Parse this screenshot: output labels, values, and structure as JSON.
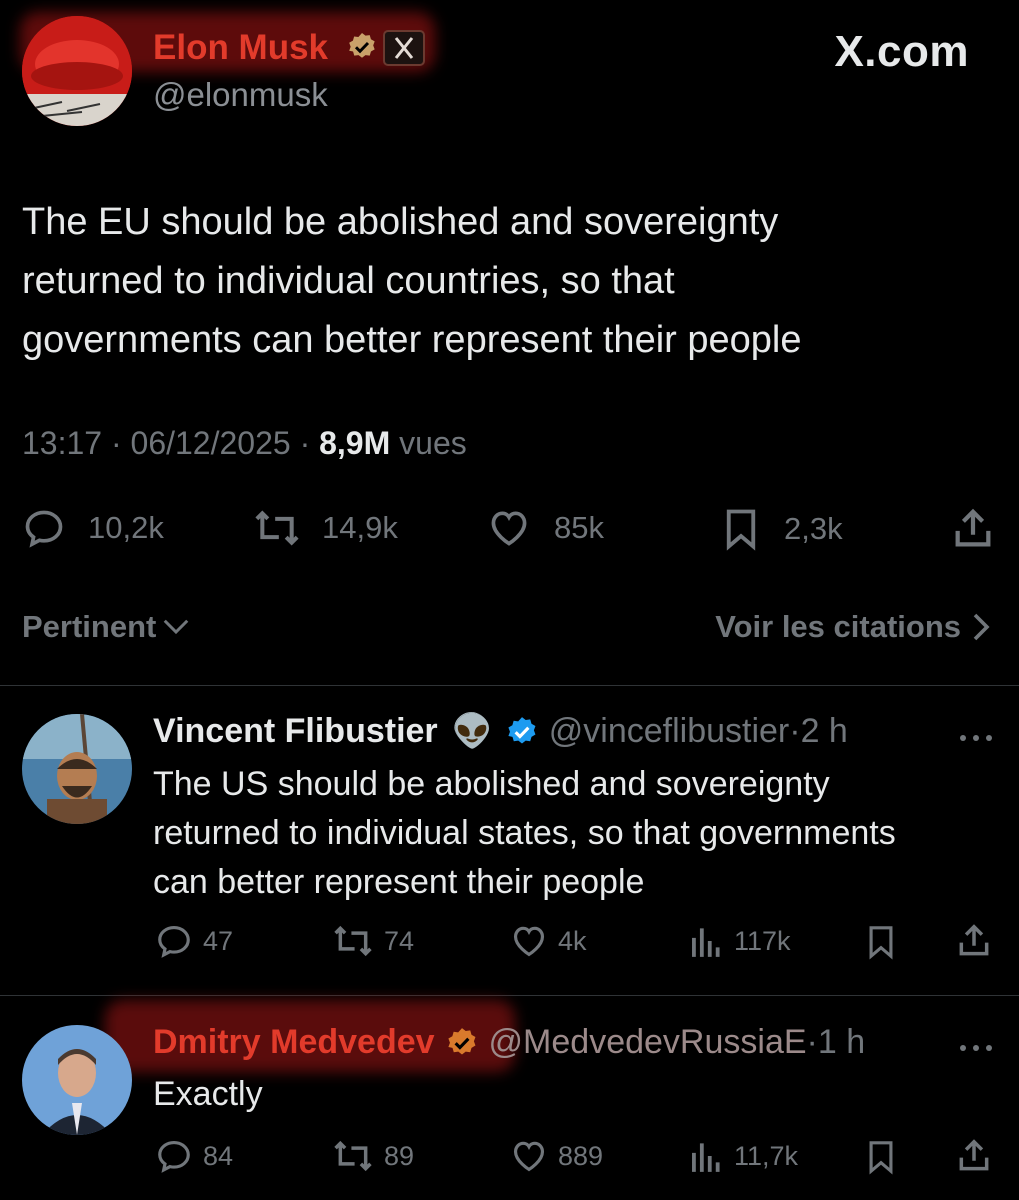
{
  "brand": {
    "site": "X.com"
  },
  "main_post": {
    "author_name": "Elon Musk",
    "author_handle": "@elonmusk",
    "text_lines": [
      "The EU should be abolished and sovereignty",
      "returned to individual countries, so that",
      "governments can better represent their people"
    ],
    "time": "13:17",
    "date": "06/12/2025",
    "views_count": "8,9M",
    "views_label": "vues",
    "stats": {
      "replies": "10,2k",
      "reposts": "14,9k",
      "likes": "85k",
      "bookmarks": "2,3k"
    }
  },
  "sort_bar": {
    "sort_label": "Pertinent",
    "quotes_link": "Voir les citations"
  },
  "replies": [
    {
      "author_name": "Vincent Flibustier",
      "emoji": "👽",
      "author_handle": "@vinceflibustier",
      "age": "2 h",
      "text_lines": [
        "The US should be abolished and sovereignty",
        "returned to individual states, so that governments",
        "can better represent their people"
      ],
      "stats": {
        "replies": "47",
        "reposts": "74",
        "likes": "4k",
        "views": "117k"
      }
    },
    {
      "author_name": "Dmitry Medvedev",
      "author_handle": "@MedvedevRussiaE",
      "age": "1 h",
      "text_lines": [
        "Exactly"
      ],
      "stats": {
        "replies": "84",
        "reposts": "89",
        "likes": "889",
        "views": "11,7k"
      }
    }
  ],
  "colors": {
    "background": "#000000",
    "text": "#e7e9ea",
    "muted": "#71767b",
    "verified_blue": "#1d9bf0",
    "verified_gold": "#e2b719",
    "highlight_red": "#c8241d"
  }
}
